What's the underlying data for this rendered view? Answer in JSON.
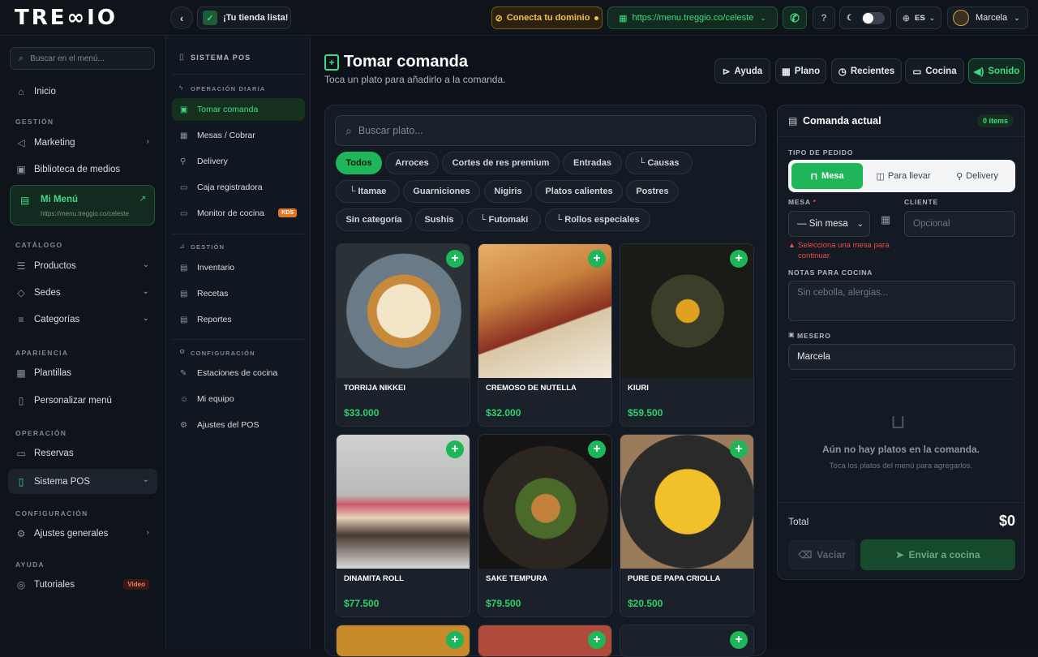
{
  "brand": {
    "logo": "TRE∞IO"
  },
  "topbar": {
    "store_ready": "¡Tu tienda lista!",
    "connect_domain": "Conecta tu dominio",
    "menu_url": "https://menu.treggio.co/celeste",
    "lang": "ES",
    "user": "Marcela"
  },
  "sidebar": {
    "search_placeholder": "Buscar en el menú...",
    "inicio": "Inicio",
    "sec_gestion": "GESTIÓN",
    "marketing": "Marketing",
    "biblioteca": "Biblioteca de medios",
    "mi_menu": "Mi Menú",
    "mi_menu_url": "https://menu.treggio.co/celeste",
    "sec_catalogo": "CATÁLOGO",
    "productos": "Productos",
    "sedes": "Sedes",
    "categorias": "Categorías",
    "sec_apariencia": "APARIENCIA",
    "plantillas": "Plantillas",
    "personalizar": "Personalizar menú",
    "sec_operacion": "OPERACIÓN",
    "reservas": "Reservas",
    "sistema_pos": "Sistema POS",
    "sec_configuracion": "CONFIGURACIÓN",
    "ajustes": "Ajustes generales",
    "sec_ayuda": "AYUDA",
    "tutoriales": "Tutoriales",
    "video_badge": "Video"
  },
  "pos_nav": {
    "title": "SISTEMA POS",
    "sec_operacion": "OPERACIÓN DIARIA",
    "tomar": "Tomar comanda",
    "mesas": "Mesas / Cobrar",
    "delivery": "Delivery",
    "caja": "Caja registradora",
    "monitor": "Monitor de cocina",
    "kds": "KDS",
    "sec_gestion": "GESTIÓN",
    "inventario": "Inventario",
    "recetas": "Recetas",
    "reportes": "Reportes",
    "sec_config": "CONFIGURACIÓN",
    "estaciones": "Estaciones de cocina",
    "equipo": "Mi equipo",
    "ajustes_pos": "Ajustes del POS"
  },
  "header": {
    "title": "Tomar comanda",
    "subtitle": "Toca un plato para añadirlo a la comanda.",
    "btn_ayuda": "Ayuda",
    "btn_plano": "Plano",
    "btn_recientes": "Recientes",
    "btn_cocina": "Cocina",
    "btn_sonido": "Sonido"
  },
  "catalog": {
    "search_placeholder": "Buscar plato...",
    "categories": [
      "Todos",
      "Arroces",
      "Cortes de res premium",
      "Entradas",
      "└ Causas",
      "└ Itamae",
      "Guarniciones",
      "Nigiris",
      "Platos calientes",
      "Postres",
      "Sin categoría",
      "Sushis",
      "└ Futomaki",
      "└ Rollos especiales"
    ],
    "dishes": [
      {
        "name": "TORRIJA NIKKEI",
        "price": "$33.000"
      },
      {
        "name": "CREMOSO DE NUTELLA",
        "price": "$32.000"
      },
      {
        "name": "KIURI",
        "price": "$59.500"
      },
      {
        "name": "DINAMITA ROLL",
        "price": "$77.500"
      },
      {
        "name": "SAKE TEMPURA",
        "price": "$79.500"
      },
      {
        "name": "PURE DE PAPA CRIOLLA",
        "price": "$20.500"
      }
    ]
  },
  "order": {
    "title": "Comanda actual",
    "items_badge": "0 items",
    "tipo_label": "TIPO DE PEDIDO",
    "types": [
      "Mesa",
      "Para llevar",
      "Delivery"
    ],
    "mesa_label": "MESA",
    "mesa_value": "— Sin mesa",
    "cliente_label": "CLIENTE",
    "cliente_placeholder": "Opcional",
    "mesa_error": "Selecciona una mesa para continuar.",
    "notas_label": "NOTAS PARA COCINA",
    "notas_placeholder": "Sin cebolla, alergias...",
    "mesero_label": "MESERO",
    "mesero_value": "Marcela",
    "empty_title": "Aún no hay platos en la comanda.",
    "empty_sub": "Toca los platos del menú para agregarlos.",
    "total_label": "Total",
    "total_value": "$0",
    "btn_vaciar": "Vaciar",
    "btn_enviar": "Enviar a cocina"
  }
}
